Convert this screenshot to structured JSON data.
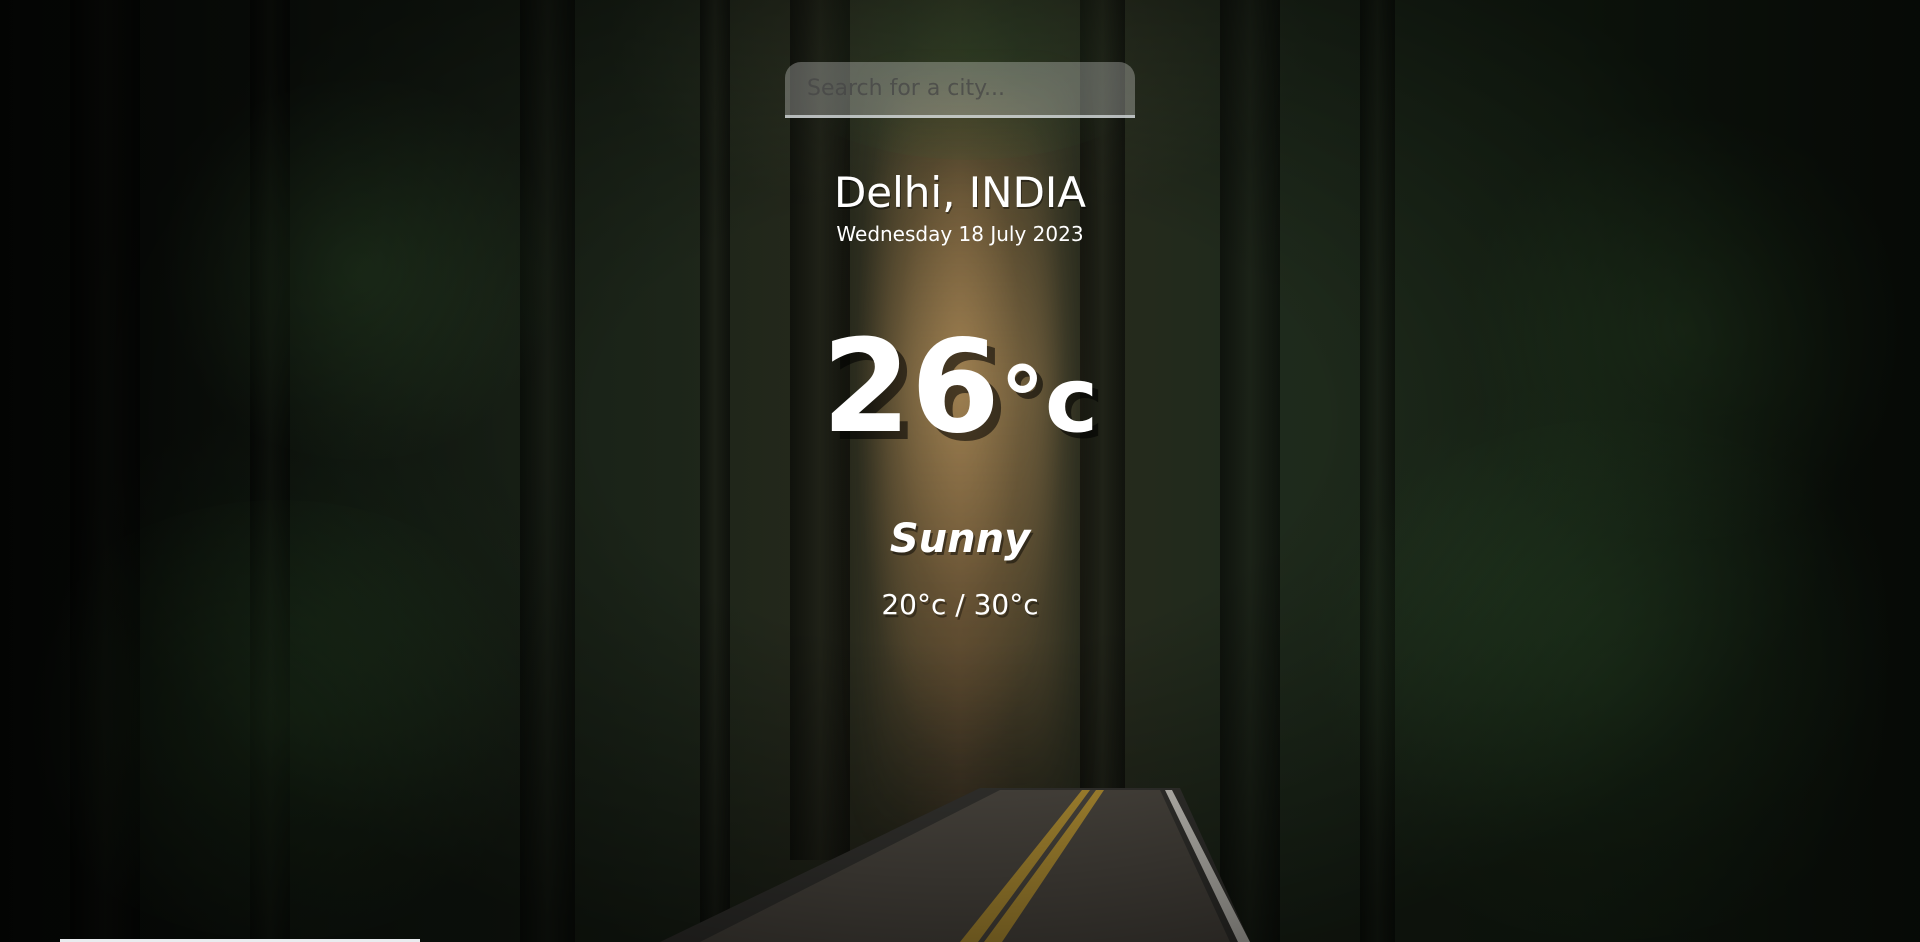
{
  "search": {
    "placeholder": "Search for a city..."
  },
  "location": {
    "city": "Delhi, INDIA",
    "date": "Wednesday 18 July 2023"
  },
  "current": {
    "temperature": "26",
    "unit": "°c"
  },
  "weather": {
    "condition": "Sunny",
    "hi_low": "20°c / 30°c"
  },
  "background": {
    "description_icon": "forest-road-image"
  },
  "colors": {
    "text": "#ffffff",
    "search_bg": "rgba(255,255,255,0.28)",
    "search_border": "#dfe5e8"
  }
}
